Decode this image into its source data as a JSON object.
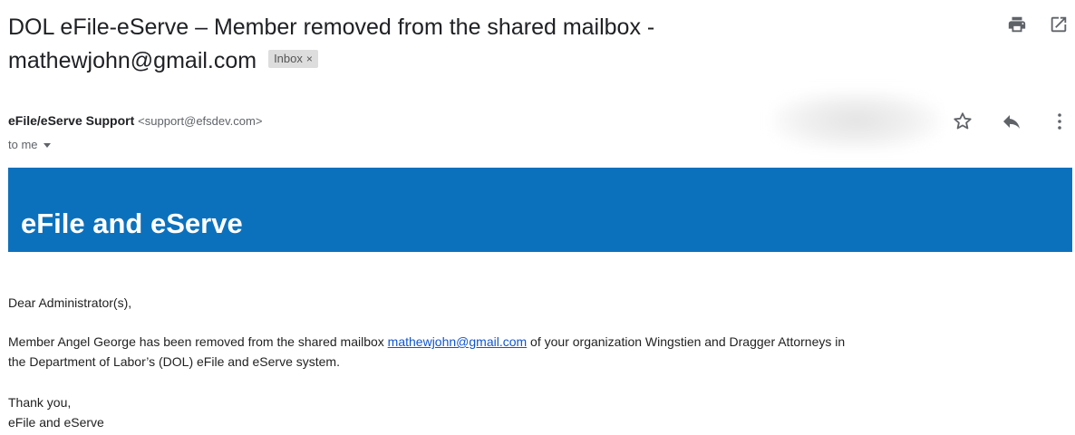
{
  "email": {
    "subject_line1": "DOL eFile-eServe – Member removed from the shared mailbox -",
    "subject_line2": "mathewjohn@gmail.com",
    "label_badge": "Inbox",
    "label_badge_close": "×",
    "sender_name": "eFile/eServe Support",
    "sender_email": "<support@efsdev.com>",
    "recipient": "to me"
  },
  "toolbar": {
    "icons": [
      "print-icon",
      "open-in-new-window-icon",
      "star-icon",
      "reply-icon",
      "more-options-icon"
    ]
  },
  "banner": {
    "title": "eFile and eServe",
    "background_color": "#0c71bd"
  },
  "message": {
    "greeting": "Dear Administrator(s),",
    "para_before_link": "Member Angel George has been removed from the shared mailbox ",
    "link_text": "mathewjohn@gmail.com",
    "para_after_link": " of your organization Wingstien and Dragger Attorneys in",
    "para_line2": "the Department of Labor’s (DOL) eFile and eServe system.",
    "closing": "Thank you,",
    "signature": "eFile and eServe"
  }
}
